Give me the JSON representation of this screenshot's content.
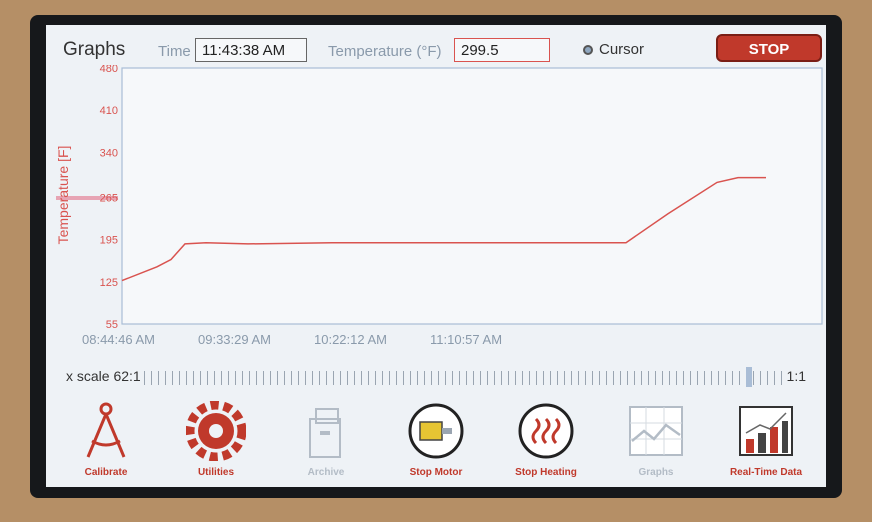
{
  "header": {
    "title": "Graphs",
    "time_label": "Time",
    "time_value": "11:43:38 AM",
    "temp_label": "Temperature (°F)",
    "temp_value": "299.5",
    "cursor_label": "Cursor",
    "stop_label": "STOP"
  },
  "chart_data": {
    "type": "line",
    "ylabel": "Temperature [F]",
    "y_ticks": [
      "480",
      "410",
      "340",
      "265",
      "195",
      "125",
      "55"
    ],
    "x_ticks": [
      "08:44:46 AM",
      "09:33:29 AM",
      "10:22:12 AM",
      "11:10:57 AM"
    ],
    "ylim": [
      55,
      480
    ],
    "grid": false,
    "series": [
      {
        "x": [
          0,
          0.05,
          0.07,
          0.09,
          0.12,
          0.18,
          0.3,
          0.45,
          0.6,
          0.72,
          0.78,
          0.85,
          0.88,
          0.92
        ],
        "y": [
          127,
          150,
          162,
          188,
          190,
          188,
          190,
          190,
          190,
          190,
          238,
          290,
          298,
          298
        ]
      }
    ]
  },
  "xscale": {
    "label": "x scale 62:1",
    "ratio": "1:1"
  },
  "colors": {
    "line": "#d9534f",
    "accent": "#c0392b",
    "frame": "#a9bdd6"
  },
  "toolbar": [
    {
      "label": "Calibrate",
      "icon": "compass-icon"
    },
    {
      "label": "Utilities",
      "icon": "gear-icon"
    },
    {
      "label": "Archive",
      "icon": "archive-box-icon"
    },
    {
      "label": "Stop Motor",
      "icon": "motor-icon"
    },
    {
      "label": "Stop Heating",
      "icon": "heating-icon"
    },
    {
      "label": "Graphs",
      "icon": "graph-icon"
    },
    {
      "label": "Real-Time Data",
      "icon": "bar-chart-icon"
    }
  ]
}
